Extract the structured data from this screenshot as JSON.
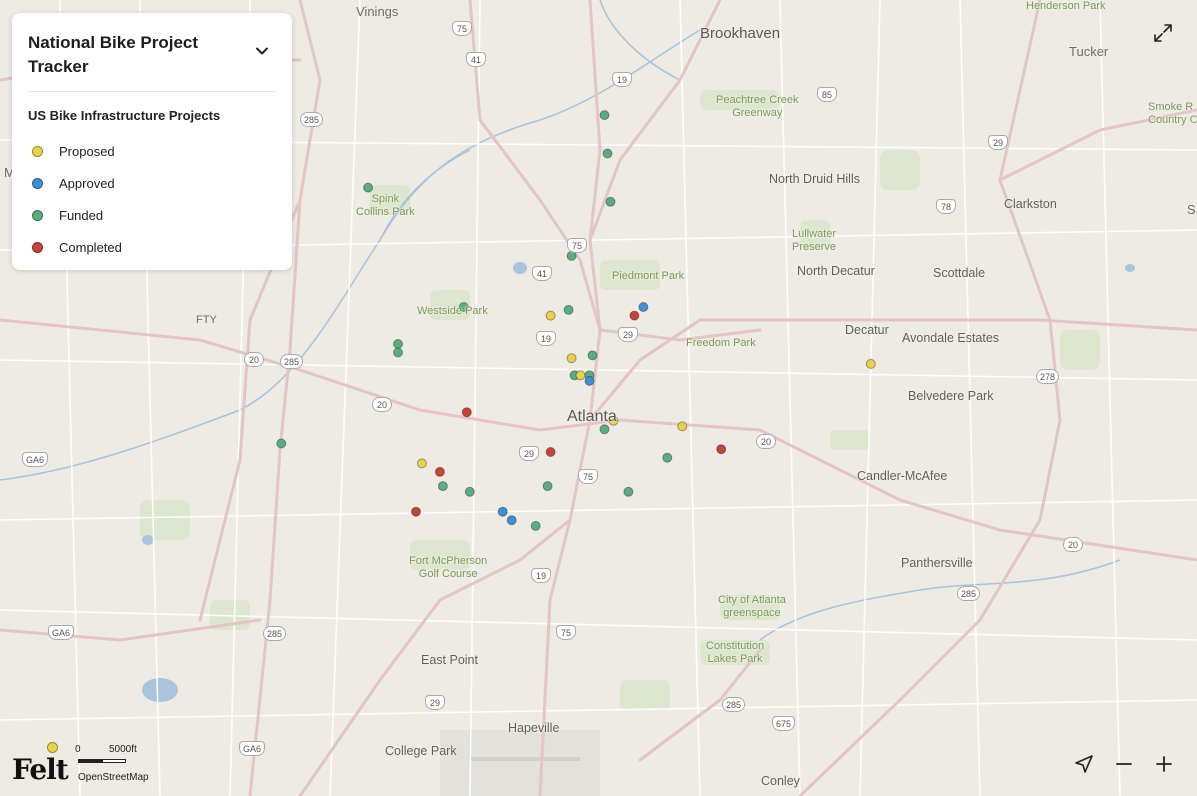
{
  "legend": {
    "title": "National Bike Project Tracker",
    "subtitle": "US Bike Infrastructure Projects",
    "items": [
      {
        "label": "Proposed",
        "color": "#e8d24a"
      },
      {
        "label": "Approved",
        "color": "#3f8fd6"
      },
      {
        "label": "Funded",
        "color": "#5aae7e"
      },
      {
        "label": "Completed",
        "color": "#c8433a"
      }
    ]
  },
  "map_labels": {
    "places": [
      "Vinings",
      "Brookhaven",
      "Henderson Park",
      "Tucker",
      "Smoke R\nCountry C",
      "Peachtree Creek\nGreenway",
      "North Druid Hills",
      "Clarkston",
      "Spink\nCollins Park",
      "Lullwater\nPreserve",
      "North Decatur",
      "Scottdale",
      "Piedmont Park",
      "Westside Park",
      "FTY",
      "Freedom Park",
      "Decatur",
      "Avondale Estates",
      "Atlanta",
      "Belvedere Park",
      "Candler-McAfee",
      "Fort McPherson\nGolf Course",
      "Panthersville",
      "City of Atlanta\ngreenspace",
      "Constitution\nLakes Park",
      "East Point",
      "Hapeville",
      "College Park",
      "Conley",
      "M",
      "S"
    ],
    "shields": [
      "75",
      "41",
      "19",
      "85",
      "285",
      "29",
      "78",
      "75",
      "41",
      "19",
      "29",
      "20",
      "285",
      "20",
      "278",
      "20",
      "29",
      "75",
      "20",
      "GA6",
      "19",
      "GA6",
      "285",
      "75",
      "285",
      "285",
      "29",
      "675",
      "GA6"
    ]
  },
  "scale": {
    "zero": "0",
    "max": "5000ft",
    "dot_color": "#e8d24a"
  },
  "attribution": "OpenStreetMap",
  "logo": "Felt",
  "icons": {
    "collapse": "chevron-down-icon",
    "expand": "expand-icon",
    "locate": "location-arrow-icon",
    "zoom_out": "minus-icon",
    "zoom_in": "plus-icon"
  },
  "projects": [
    {
      "status": "Funded",
      "lat": 33.8795,
      "lon": -84.387
    },
    {
      "status": "Funded",
      "lat": 33.866,
      "lon": -84.386
    },
    {
      "status": "Funded",
      "lat": 33.849,
      "lon": -84.385
    },
    {
      "status": "Funded",
      "lat": 33.854,
      "lon": -84.466
    },
    {
      "status": "Funded",
      "lat": 33.83,
      "lon": -84.398
    },
    {
      "status": "Proposed",
      "lat": 33.809,
      "lon": -84.405
    },
    {
      "status": "Funded",
      "lat": 33.811,
      "lon": -84.399
    },
    {
      "status": "Completed",
      "lat": 33.809,
      "lon": -84.377
    },
    {
      "status": "Approved",
      "lat": 33.812,
      "lon": -84.374
    },
    {
      "status": "Funded",
      "lat": 33.812,
      "lon": -84.434
    },
    {
      "status": "Funded",
      "lat": 33.799,
      "lon": -84.456
    },
    {
      "status": "Funded",
      "lat": 33.796,
      "lon": -84.456
    },
    {
      "status": "Proposed",
      "lat": 33.794,
      "lon": -84.398
    },
    {
      "status": "Funded",
      "lat": 33.795,
      "lon": -84.391
    },
    {
      "status": "Funded",
      "lat": 33.788,
      "lon": -84.397
    },
    {
      "status": "Proposed",
      "lat": 33.788,
      "lon": -84.395
    },
    {
      "status": "Funded",
      "lat": 33.788,
      "lon": -84.392
    },
    {
      "status": "Approved",
      "lat": 33.786,
      "lon": -84.392
    },
    {
      "status": "Proposed",
      "lat": 33.792,
      "lon": -84.298
    },
    {
      "status": "Completed",
      "lat": 33.775,
      "lon": -84.433
    },
    {
      "status": "Proposed",
      "lat": 33.772,
      "lon": -84.384
    },
    {
      "status": "Funded",
      "lat": 33.769,
      "lon": -84.387
    },
    {
      "status": "Proposed",
      "lat": 33.77,
      "lon": -84.361
    },
    {
      "status": "Completed",
      "lat": 33.762,
      "lon": -84.348
    },
    {
      "status": "Funded",
      "lat": 33.764,
      "lon": -84.495
    },
    {
      "status": "Completed",
      "lat": 33.761,
      "lon": -84.405
    },
    {
      "status": "Funded",
      "lat": 33.759,
      "lon": -84.366
    },
    {
      "status": "Proposed",
      "lat": 33.757,
      "lon": -84.448
    },
    {
      "status": "Completed",
      "lat": 33.754,
      "lon": -84.442
    },
    {
      "status": "Funded",
      "lat": 33.749,
      "lon": -84.441
    },
    {
      "status": "Funded",
      "lat": 33.747,
      "lon": -84.432
    },
    {
      "status": "Funded",
      "lat": 33.749,
      "lon": -84.406
    },
    {
      "status": "Funded",
      "lat": 33.747,
      "lon": -84.379
    },
    {
      "status": "Completed",
      "lat": 33.74,
      "lon": -84.45
    },
    {
      "status": "Approved",
      "lat": 33.74,
      "lon": -84.421
    },
    {
      "status": "Approved",
      "lat": 33.737,
      "lon": -84.418
    },
    {
      "status": "Funded",
      "lat": 33.735,
      "lon": -84.41
    }
  ]
}
